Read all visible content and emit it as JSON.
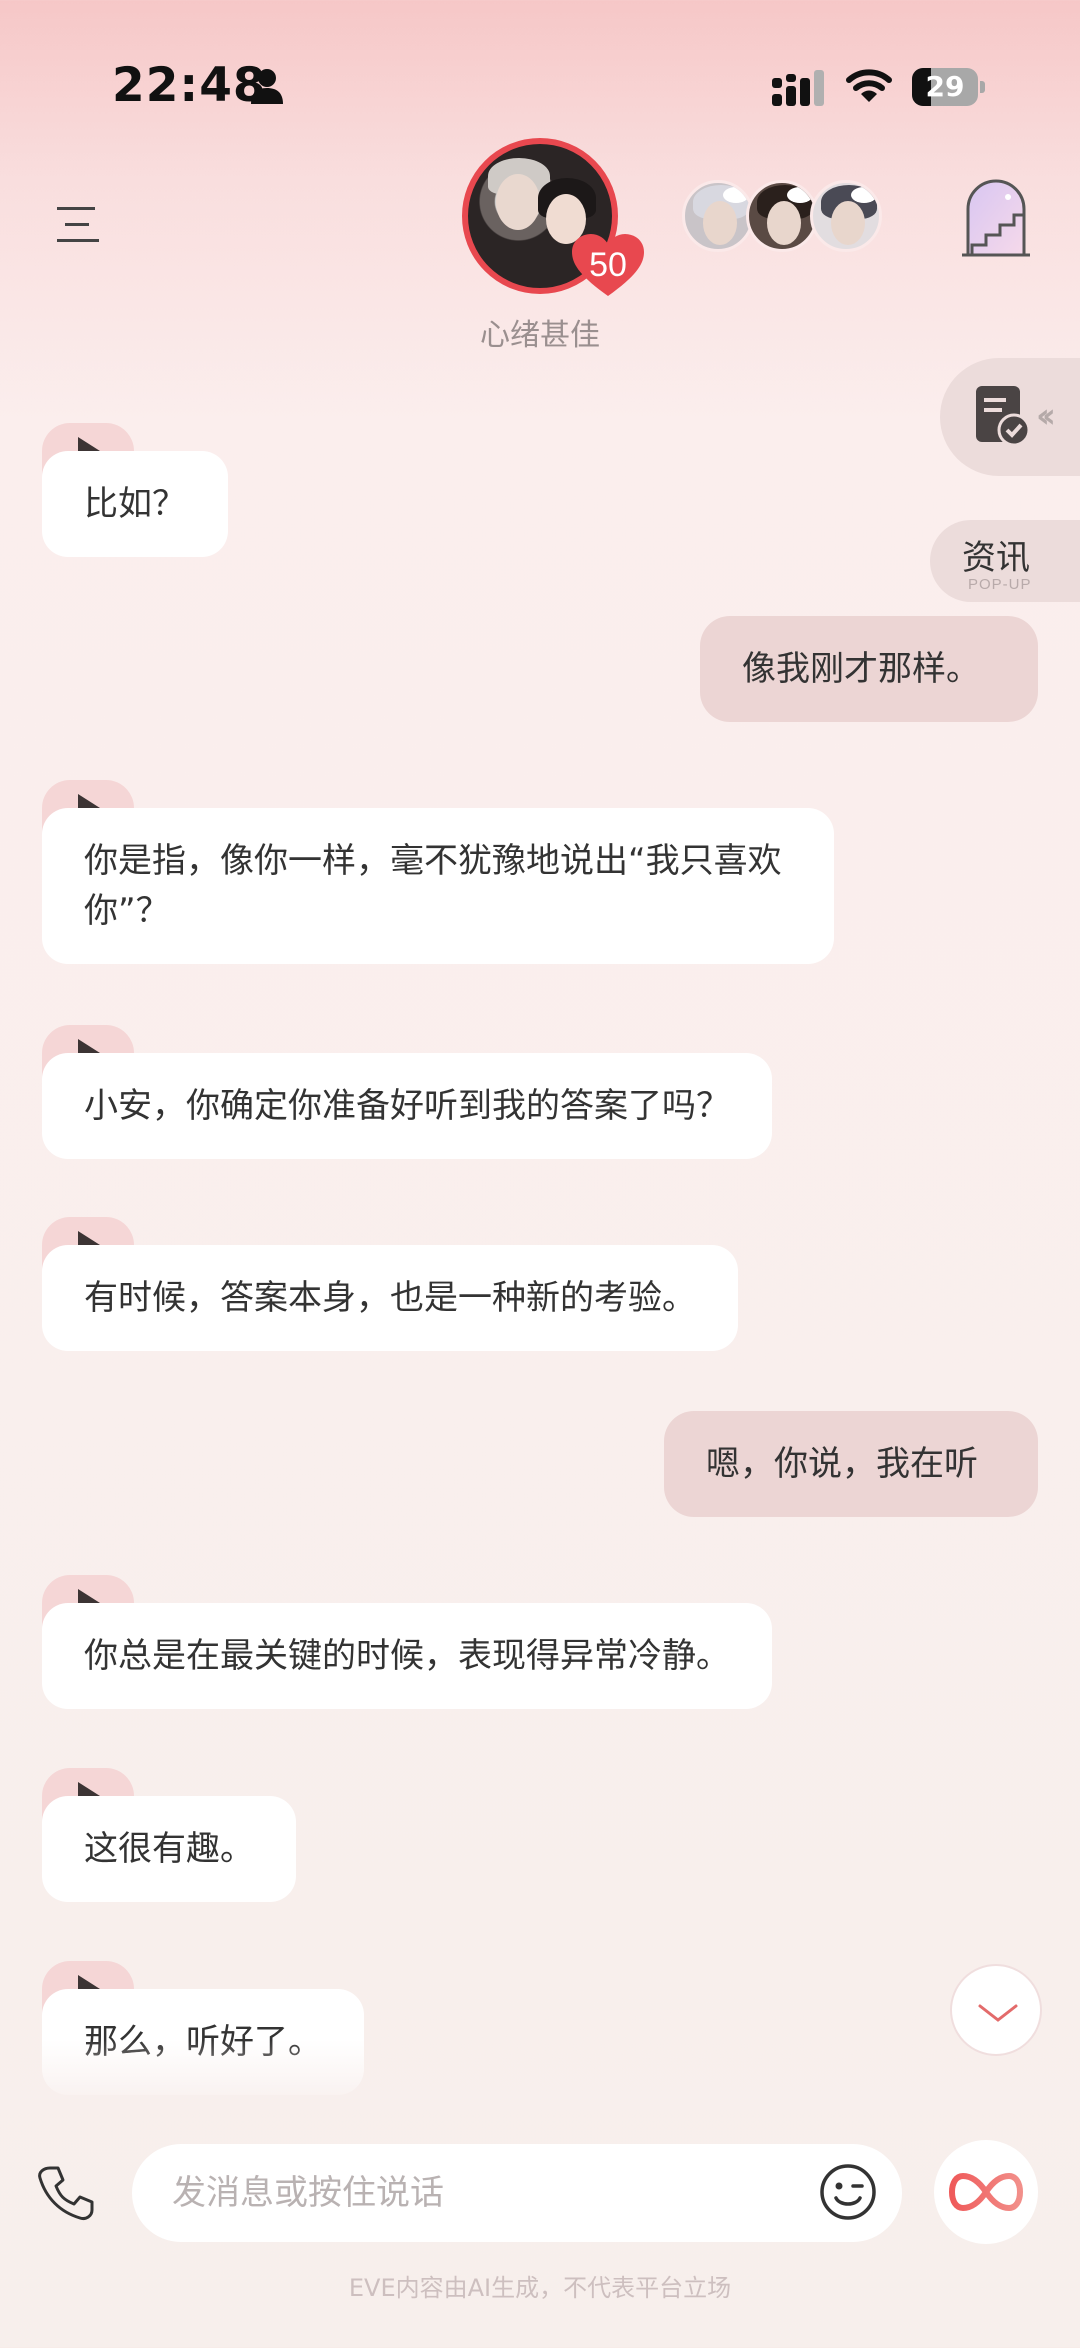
{
  "status_bar": {
    "time": "22:48",
    "battery_level": "29",
    "battery_fraction": 0.29
  },
  "header": {
    "heart_count": "50",
    "mood": "心绪甚佳"
  },
  "side_buttons": {
    "news_label": "资讯",
    "news_sub": "POP-UP"
  },
  "messages": [
    {
      "side": "left",
      "text": "比如？"
    },
    {
      "side": "right",
      "text": "像我刚才那样。"
    },
    {
      "side": "left",
      "text": "你是指，像你一样，毫不犹豫地说出“我只喜欢你”？"
    },
    {
      "side": "left",
      "text": "小安，你确定你准备好听到我的答案了吗？"
    },
    {
      "side": "left",
      "text": "有时候，答案本身，也是一种新的考验。"
    },
    {
      "side": "right",
      "text": "嗯，你说，我在听"
    },
    {
      "side": "left",
      "text": "你总是在最关键的时候，表现得异常冷静。"
    },
    {
      "side": "left",
      "text": "这很有趣。"
    },
    {
      "side": "left",
      "text": "那么，听好了。"
    }
  ],
  "input": {
    "placeholder": "发消息或按住说话"
  },
  "footer": {
    "note": "EVE内容由AI生成，不代表平台立场"
  },
  "colors": {
    "accent": "#e8484f",
    "user_bubble": "#ecd5d4",
    "play_tab": "#f5d6d6"
  }
}
